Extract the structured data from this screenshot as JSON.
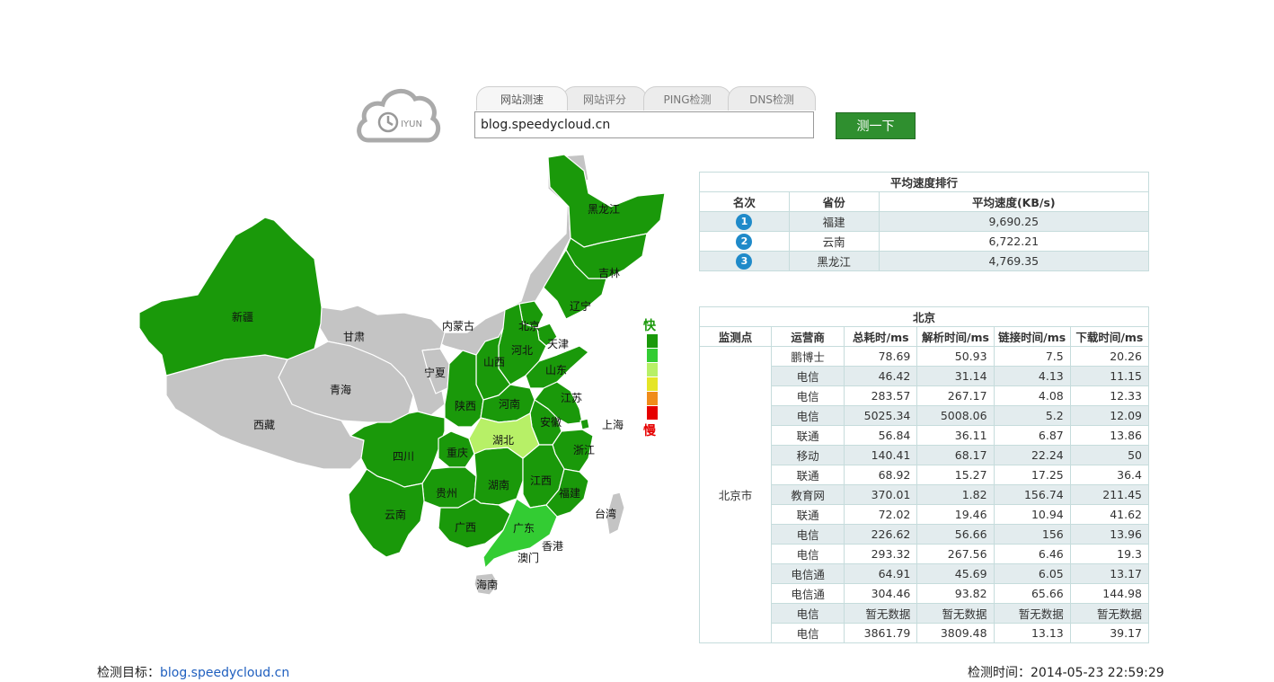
{
  "logo": {
    "text": "IYUN"
  },
  "tabs": [
    {
      "label": "网站测速"
    },
    {
      "label": "网站评分"
    },
    {
      "label": "PING检测"
    },
    {
      "label": "DNS检测"
    }
  ],
  "search": {
    "value": "blog.speedycloud.cn",
    "button_label": "测一下"
  },
  "map": {
    "provinces": {
      "heilongjiang": "黑龙江",
      "jilin": "吉林",
      "liaoning": "辽宁",
      "neimenggu": "内蒙古",
      "xinjiang": "新疆",
      "gansu": "甘肃",
      "ningxia": "宁夏",
      "qinghai": "青海",
      "xizang": "西藏",
      "beijing": "北京",
      "tianjin": "天津",
      "hebei": "河北",
      "shanxi": "山西",
      "shandong": "山东",
      "shaanxi": "陕西",
      "henan": "河南",
      "jiangsu": "江苏",
      "anhui": "安徽",
      "shanghai": "上海",
      "hubei": "湖北",
      "sichuan": "四川",
      "chongqing": "重庆",
      "zhejiang": "浙江",
      "guizhou": "贵州",
      "hunan": "湖南",
      "jiangxi": "江西",
      "fujian": "福建",
      "yunnan": "云南",
      "guangxi": "广西",
      "guangdong": "广东",
      "taiwan": "台湾",
      "hongkong": "香港",
      "macau": "澳门",
      "hainan": "海南"
    },
    "colors": {
      "dark_green": "#1a990a",
      "light_green": "#33cc33",
      "lime": "#b7f067",
      "no_data": "#c4c4c4",
      "border": "#ffffff"
    },
    "legend": {
      "fast_label": "快",
      "slow_label": "慢",
      "levels": [
        "#1a990a",
        "#33cc33",
        "#e5e526",
        "#f08c1a",
        "#e60000"
      ]
    }
  },
  "rank": {
    "title": "平均速度排行",
    "headers": [
      "名次",
      "省份",
      "平均速度(KB/s)"
    ],
    "rows": [
      {
        "rank": "1",
        "province": "福建",
        "speed": "9,690.25"
      },
      {
        "rank": "2",
        "province": "云南",
        "speed": "6,722.21"
      },
      {
        "rank": "3",
        "province": "黑龙江",
        "speed": "4,769.35"
      }
    ]
  },
  "detail": {
    "title": "北京",
    "headers": [
      "监测点",
      "运营商",
      "总耗时/ms",
      "解析时间/ms",
      "链接时间/ms",
      "下载时间/ms"
    ],
    "location": "北京市",
    "rows": [
      {
        "isp": "鹏博士",
        "total": "78.69",
        "dns": "50.93",
        "connect": "7.5",
        "download": "20.26"
      },
      {
        "isp": "电信",
        "total": "46.42",
        "dns": "31.14",
        "connect": "4.13",
        "download": "11.15"
      },
      {
        "isp": "电信",
        "total": "283.57",
        "dns": "267.17",
        "connect": "4.08",
        "download": "12.33"
      },
      {
        "isp": "电信",
        "total": "5025.34",
        "dns": "5008.06",
        "connect": "5.2",
        "download": "12.09"
      },
      {
        "isp": "联通",
        "total": "56.84",
        "dns": "36.11",
        "connect": "6.87",
        "download": "13.86"
      },
      {
        "isp": "移动",
        "total": "140.41",
        "dns": "68.17",
        "connect": "22.24",
        "download": "50"
      },
      {
        "isp": "联通",
        "total": "68.92",
        "dns": "15.27",
        "connect": "17.25",
        "download": "36.4"
      },
      {
        "isp": "教育网",
        "total": "370.01",
        "dns": "1.82",
        "connect": "156.74",
        "download": "211.45"
      },
      {
        "isp": "联通",
        "total": "72.02",
        "dns": "19.46",
        "connect": "10.94",
        "download": "41.62"
      },
      {
        "isp": "电信",
        "total": "226.62",
        "dns": "56.66",
        "connect": "156",
        "download": "13.96"
      },
      {
        "isp": "电信",
        "total": "293.32",
        "dns": "267.56",
        "connect": "6.46",
        "download": "19.3"
      },
      {
        "isp": "电信通",
        "total": "64.91",
        "dns": "45.69",
        "connect": "6.05",
        "download": "13.17"
      },
      {
        "isp": "电信通",
        "total": "304.46",
        "dns": "93.82",
        "connect": "65.66",
        "download": "144.98"
      },
      {
        "isp": "电信",
        "total": "暂无数据",
        "dns": "暂无数据",
        "connect": "暂无数据",
        "download": "暂无数据"
      },
      {
        "isp": "电信",
        "total": "3861.79",
        "dns": "3809.48",
        "connect": "13.13",
        "download": "39.17"
      }
    ]
  },
  "footer": {
    "target_label": "检测目标：",
    "target_value": "blog.speedycloud.cn",
    "time_label": "检测时间：",
    "time_value": "2014-05-23 22:59:29"
  }
}
